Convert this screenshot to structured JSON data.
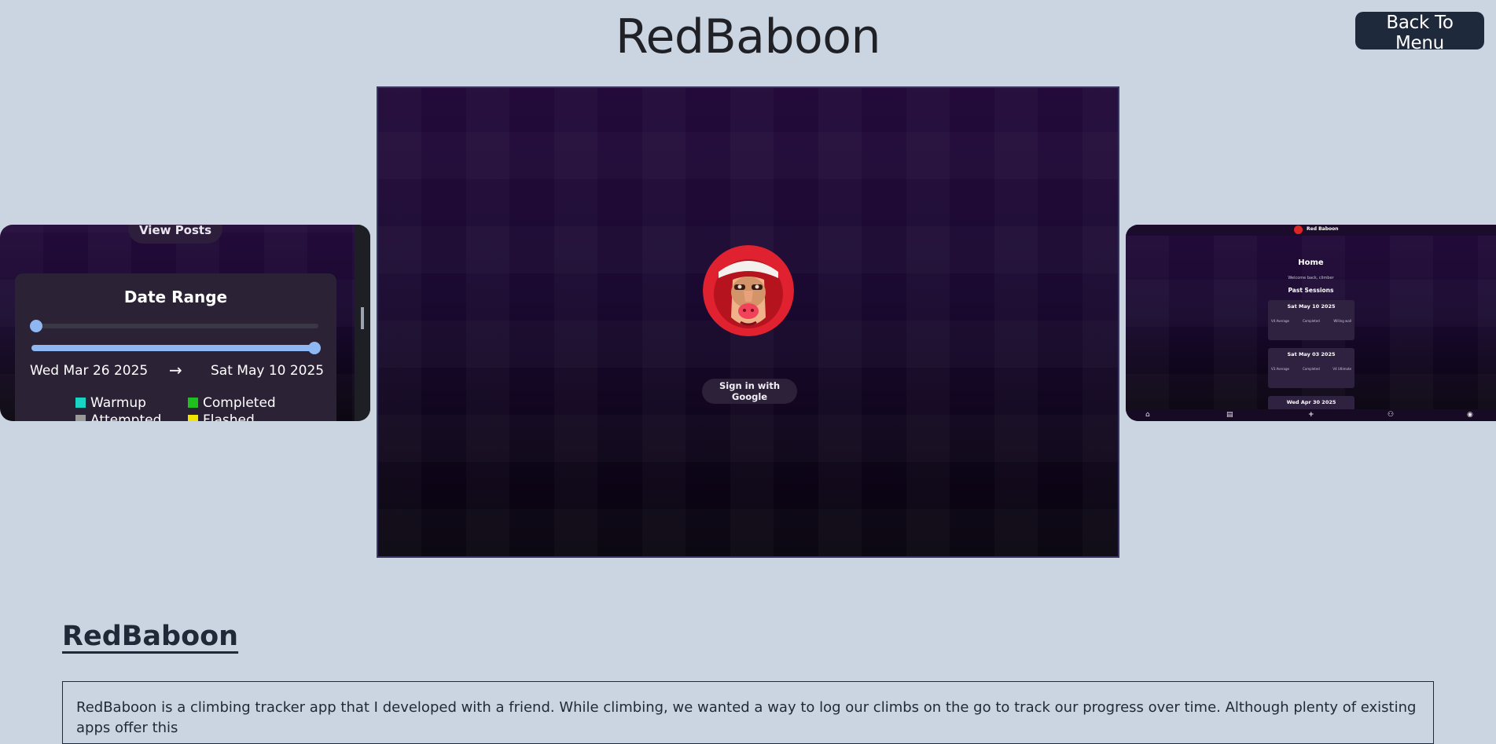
{
  "header": {
    "title": "RedBaboon",
    "back_label": "Back To Menu"
  },
  "carousel": {
    "left_slide": {
      "view_posts_label": "View Posts",
      "date_range_title": "Date Range",
      "range_start_value": 0,
      "range_end_value": 1,
      "start_date": "Wed Mar 26 2025",
      "arrow": "→",
      "end_date": "Sat May 10 2025",
      "legend": [
        {
          "label": "Warmup",
          "color": "#19d3c5"
        },
        {
          "label": "Completed",
          "color": "#1fbf1f"
        },
        {
          "label": "Attempted",
          "color": "#9a9a9a"
        },
        {
          "label": "Flashed",
          "color": "#f2e600"
        }
      ]
    },
    "center_slide": {
      "signin_label": "Sign in with Google",
      "logo_name": "red-baboon-logo"
    },
    "right_slide": {
      "brand": "Red Baboon",
      "home_title": "Home",
      "tiny_text": "Welcome back, climber",
      "past_sessions": "Past Sessions",
      "sessions": [
        {
          "date": "Sat May 10 2025",
          "left": "V4 Average",
          "mid": "Completed",
          "right": "Willing wall"
        },
        {
          "date": "Sat May 03 2025",
          "left": "V3 Average",
          "mid": "Completed",
          "right": "V4 Ultimate"
        },
        {
          "date": "Wed Apr 30 2025",
          "left": "",
          "mid": "",
          "right": ""
        }
      ],
      "nav_icons": [
        "home-icon",
        "journal-icon",
        "add-icon",
        "users-icon",
        "avatar"
      ]
    }
  },
  "section": {
    "title": "RedBaboon",
    "description": "RedBaboon is a climbing tracker app that I developed with a friend. While climbing, we wanted a way to log our climbs on the go to track our progress over time. Although plenty of existing apps offer this"
  }
}
